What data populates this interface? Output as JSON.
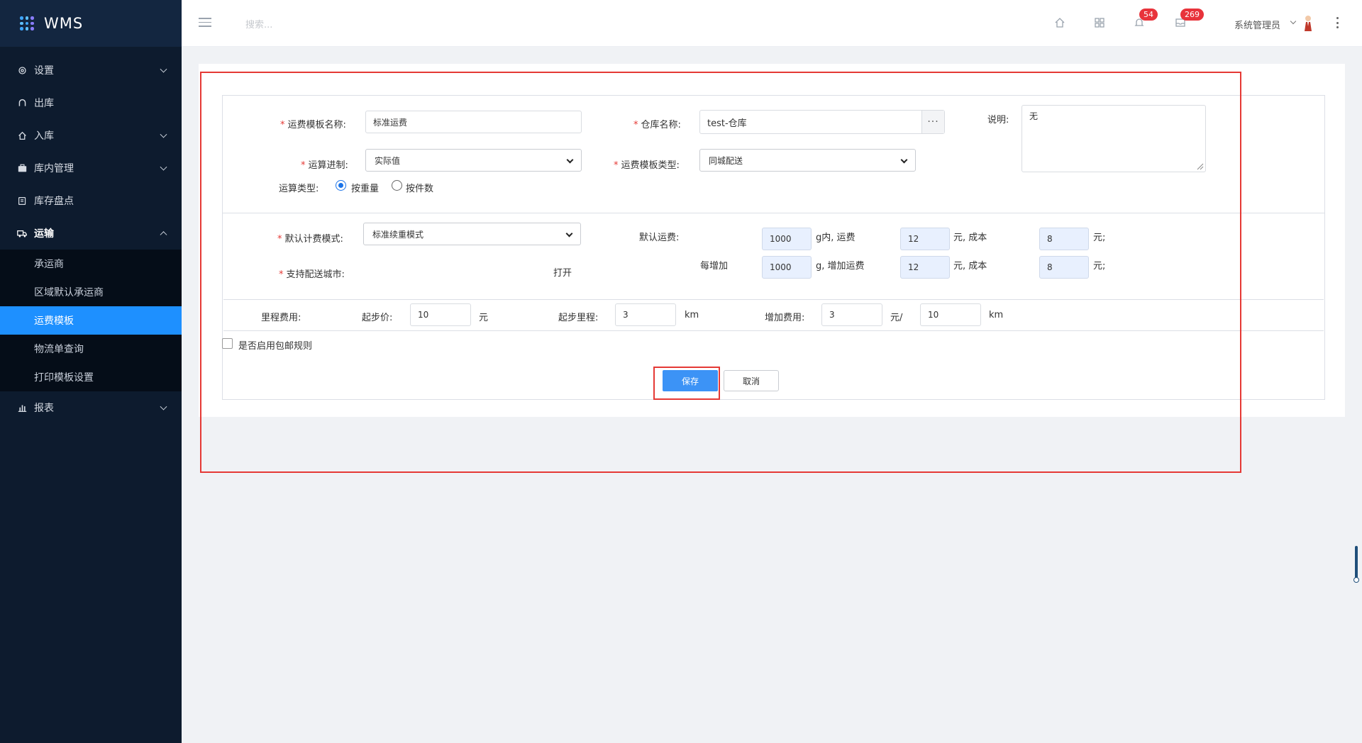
{
  "app": {
    "title": "WMS"
  },
  "sidebar": {
    "items": [
      {
        "label": "设置",
        "icon": "gear-icon",
        "expandable": true,
        "open": false
      },
      {
        "label": "出库",
        "icon": "outbound-icon",
        "expandable": false
      },
      {
        "label": "入库",
        "icon": "inbound-icon",
        "expandable": true,
        "open": false
      },
      {
        "label": "库内管理",
        "icon": "warehouse-icon",
        "expandable": true,
        "open": false
      },
      {
        "label": "库存盘点",
        "icon": "inventory-icon",
        "expandable": false
      },
      {
        "label": "运输",
        "icon": "truck-icon",
        "expandable": true,
        "open": true
      },
      {
        "label": "报表",
        "icon": "bar-chart-icon",
        "expandable": true,
        "open": false
      }
    ],
    "transport_sub": [
      {
        "label": "承运商",
        "active": false
      },
      {
        "label": "区域默认承运商",
        "active": false
      },
      {
        "label": "运费模板",
        "active": true
      },
      {
        "label": "物流单查询",
        "active": false
      },
      {
        "label": "打印模板设置",
        "active": false
      }
    ]
  },
  "header": {
    "search_placeholder": "搜索...",
    "notifications_count": "54",
    "messages_count": "269",
    "user_name": "系统管理员"
  },
  "form": {
    "template_name_label": "运费模板名称:",
    "template_name_value": "标准运费",
    "warehouse_label": "仓库名称:",
    "warehouse_value": "test-仓库",
    "warehouse_browse": "···",
    "desc_label": "说明:",
    "desc_value": "无",
    "carry_label": "运算进制:",
    "carry_value": "实际值",
    "template_type_label": "运费模板类型:",
    "template_type_value": "同城配送",
    "calc_type_label": "运算类型:",
    "calc_type_options": [
      "按重量",
      "按件数"
    ],
    "calc_type_selected": "按重量",
    "billing_mode_label": "默认计费模式:",
    "billing_mode_value": "标准续重模式",
    "default_fee_label": "默认运费:",
    "default_weight": "1000",
    "default_weight_text": "g内, 运费",
    "default_fee": "12",
    "yuan_cost_text": "元, 成本",
    "default_cost": "8",
    "yuan_end": "元;",
    "each_add_label": "每增加",
    "add_weight": "1000",
    "add_weight_text": "g, 增加运费",
    "add_fee": "12",
    "add_cost": "8",
    "cities_label": "支持配送城市:",
    "cities_value": "打开",
    "mileage_label": "里程费用:",
    "start_price_label": "起步价:",
    "start_price_value": "10",
    "yuan": "元",
    "start_mileage_label": "起步里程:",
    "start_mileage_value": "3",
    "km": "km",
    "add_fee_label": "增加费用:",
    "add_fee_value": "3",
    "yuan_per": "元/",
    "per_km_value": "10",
    "free_shipping_label": "是否启用包邮规则",
    "save_label": "保存",
    "cancel_label": "取消"
  },
  "colors": {
    "sidebar_bg": "#0d1b2e",
    "active_item": "#1e90ff",
    "highlight_border": "#e53935",
    "primary_button": "#3c93f6"
  }
}
